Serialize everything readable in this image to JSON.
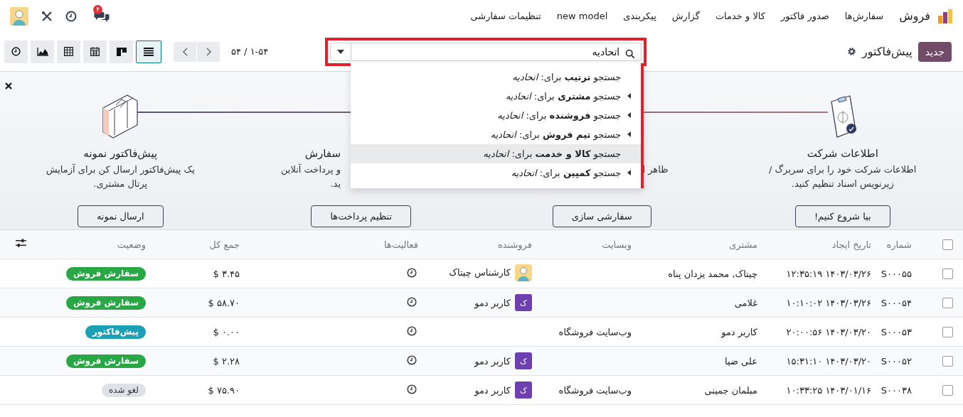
{
  "navbar": {
    "app_name": "فروش",
    "menus": [
      "سفارش‌ها",
      "صدور فاکتور",
      "کالا و خدمات",
      "گزارش",
      "پیکربندی",
      "new model",
      "تنظیمات سفارشی"
    ],
    "chat_badge": "۴"
  },
  "control_panel": {
    "new_button": "جدید",
    "title": "پیش‌فاکتور",
    "pager": "۱-۵۴ / ۵۴",
    "views": [
      {
        "kind": "list",
        "selected": true
      },
      {
        "kind": "kanban",
        "selected": false
      },
      {
        "kind": "calendar",
        "selected": false
      },
      {
        "kind": "pivot",
        "selected": false
      },
      {
        "kind": "graph",
        "selected": false
      },
      {
        "kind": "activity",
        "selected": false
      }
    ]
  },
  "search": {
    "value": "اتحادیه",
    "options": [
      {
        "text": "جستجو **ترتیب** برای: *اتحادیه*",
        "expandable": false,
        "selected": false
      },
      {
        "text": "جستجو **مشتری** برای: *اتحادیه*",
        "expandable": true,
        "selected": false
      },
      {
        "text": "جستجو **فروشنده** برای: *اتحادیه*",
        "expandable": true,
        "selected": false
      },
      {
        "text": "جستجو **تیم فروش** برای: *اتحادیه*",
        "expandable": true,
        "selected": false
      },
      {
        "text": "جستجو **کالا و خدمت** برای: *اتحادیه*",
        "expandable": false,
        "selected": true
      },
      {
        "text": "جستجو **کمپین** برای: *اتحادیه*",
        "expandable": true,
        "selected": false
      }
    ]
  },
  "onboarding": {
    "steps": [
      {
        "kind": "company",
        "title": "اطلاعات شرکت",
        "description_lines": [
          "اطلاعات شرکت خود را برای سربرگ /",
          "زیرنویس اسناد تنظیم کنید."
        ],
        "button": "بیا شروع کنیم!"
      },
      {
        "kind": "rightpart",
        "description_lines": [
          "ظاهر ا"
        ],
        "button": "سفارشی سازی"
      },
      {
        "kind": "leftpart",
        "title": "سفارش",
        "description_lines": [
          "و پرداخت آنلاین",
          "ید."
        ],
        "button": "تنظیم پرداخت‌ها"
      },
      {
        "kind": "sample",
        "title": "پیش‌فاکتور نمونه",
        "description_lines": [
          "یک پیش‌فاکتور ارسال کن برای آزمایش",
          "پرتال مشتری."
        ],
        "button": "ارسال نمونه"
      }
    ]
  },
  "table": {
    "select_all": false,
    "columns": [
      "شماره",
      "تاریخ ایجاد",
      "مشتری",
      "وبسایت",
      "فروشنده",
      "فعالیت‌ها",
      "جمع کل",
      "وضعیت"
    ],
    "rows": [
      {
        "selected": false,
        "number": "S۰۰۰۵۵",
        "created": "۱۴۰۳/۰۳/۲۶ ۱۲:۳۵:۱۹",
        "customer": "چیتاک, محمد یزدان پناه",
        "salesperson": {
          "name": "کارشناس چیتاک",
          "kind": "image"
        },
        "total": "$ ۳.۴۵",
        "status": {
          "label": "سفارش فروش",
          "kind": "sale"
        }
      },
      {
        "selected": false,
        "number": "S۰۰۰۵۴",
        "created": "۱۴۰۳/۰۳/۲۶ ۱۰:۱۰:۰۲",
        "customer": "غلامی",
        "salesperson": {
          "name": "کاربر دمو",
          "kind": "letter",
          "letter": "ک"
        },
        "total": "$ ۵۸.۷۰",
        "status": {
          "label": "سفارش فروش",
          "kind": "sale"
        }
      },
      {
        "selected": false,
        "number": "S۰۰۰۵۳",
        "created": "۱۴۰۳/۰۳/۲۰ ۲۰:۰۰:۵۶",
        "customer": "کاربر دمو",
        "website": "وب‌سایت فروشگاه",
        "total": "$ ۰.۰۰",
        "status": {
          "label": "پیش‌فاکتور",
          "kind": "quotation"
        }
      },
      {
        "selected": false,
        "number": "S۰۰۰۵۲",
        "created": "۱۴۰۳/۰۳/۲۰ ۱۵:۳۱:۱۰",
        "customer": "علی ضیا",
        "salesperson": {
          "name": "کاربر دمو",
          "kind": "letter",
          "letter": "ک"
        },
        "total": "$ ۲.۲۸",
        "status": {
          "label": "سفارش فروش",
          "kind": "sale"
        }
      },
      {
        "selected": false,
        "number": "S۰۰۰۳۸",
        "created": "۱۴۰۳/۰۱/۱۶ ۱۰:۳۳:۲۵",
        "customer": "مبلمان جمینی",
        "website": "وب‌سایت فروشگاه",
        "salesperson": {
          "name": "کاربر دمو",
          "kind": "letter",
          "letter": "ک"
        },
        "total": "$ ۷۵.۹۰",
        "status": {
          "label": "لغو شده",
          "kind": "cancel"
        }
      }
    ]
  }
}
